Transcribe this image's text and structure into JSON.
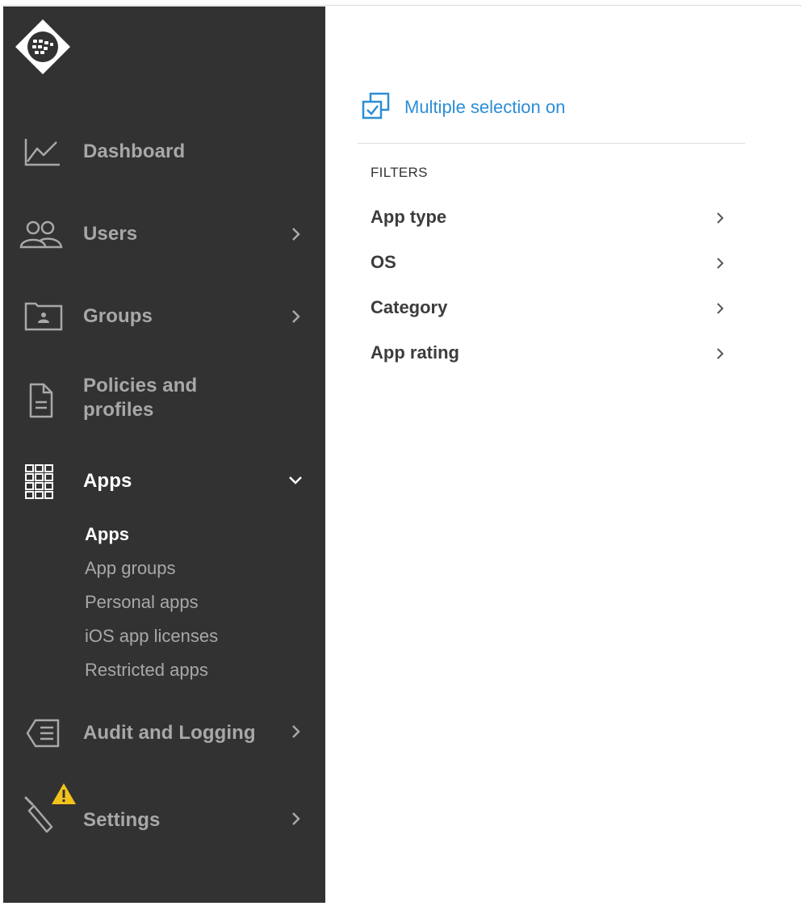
{
  "sidebar": {
    "items": [
      {
        "label": "Dashboard",
        "icon": "chart-line-icon"
      },
      {
        "label": "Users",
        "icon": "users-icon"
      },
      {
        "label": "Groups",
        "icon": "folder-user-icon"
      },
      {
        "label": "Policies and",
        "label2": "profiles",
        "icon": "document-icon"
      },
      {
        "label": "Apps",
        "icon": "apps-grid-icon",
        "expanded": true
      },
      {
        "label": "Audit and Logging",
        "icon": "audit-log-icon"
      },
      {
        "label": "Settings",
        "icon": "wrench-icon",
        "warning": true
      }
    ],
    "apps_submenu": [
      {
        "label": "Apps",
        "active": true
      },
      {
        "label": "App groups"
      },
      {
        "label": "Personal apps"
      },
      {
        "label": "iOS app licenses"
      },
      {
        "label": "Restricted apps"
      }
    ]
  },
  "main": {
    "multi_select_label": "Multiple selection on",
    "filters_heading": "FILTERS",
    "filters": [
      {
        "label": "App type"
      },
      {
        "label": "OS"
      },
      {
        "label": "Category"
      },
      {
        "label": "App rating"
      }
    ]
  },
  "colors": {
    "sidebar_bg": "#323232",
    "link_blue": "#2b8ed6",
    "warning": "#f2c21b"
  }
}
